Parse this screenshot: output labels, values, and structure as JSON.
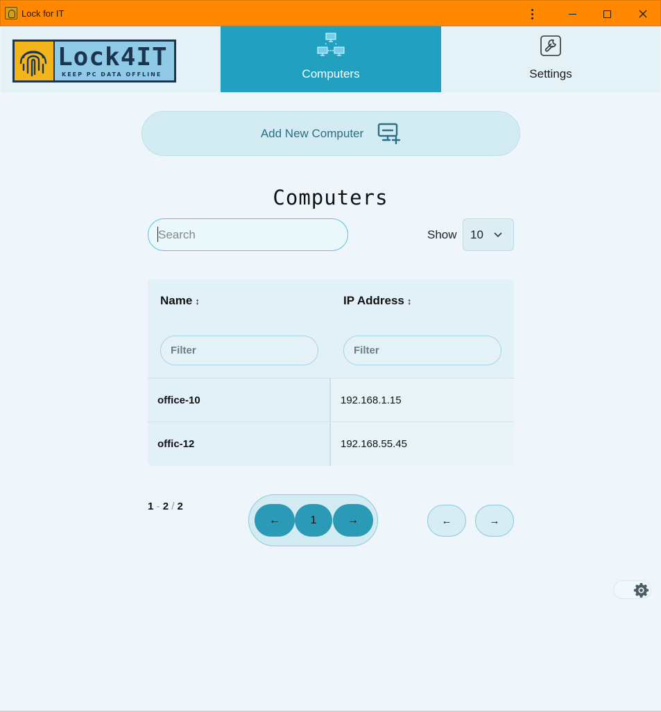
{
  "window": {
    "title": "Lock for IT",
    "controls": {
      "more": "more-options",
      "minimize": "minimize",
      "maximize": "maximize",
      "close": "close"
    }
  },
  "header": {
    "logo": {
      "main": "Lock4IT",
      "tagline": "KEEP PC DATA OFFLINE"
    },
    "tabs": [
      {
        "label": "Computers",
        "icon": "network-icon",
        "active": true
      },
      {
        "label": "Settings",
        "icon": "wrench-icon",
        "active": false
      }
    ]
  },
  "actions": {
    "add_computer_label": "Add New Computer",
    "add_computer_icon": "monitor-add-icon"
  },
  "page": {
    "title": "Computers"
  },
  "search": {
    "placeholder": "Search",
    "value": ""
  },
  "show": {
    "label": "Show",
    "selected": "10"
  },
  "table": {
    "columns": [
      {
        "label": "Name",
        "sort_icon": "↕",
        "filter_placeholder": "Filter"
      },
      {
        "label": "IP Address",
        "sort_icon": "↕",
        "filter_placeholder": "Filter"
      }
    ],
    "rows": [
      {
        "name": "office-10",
        "ip": "192.168.1.15"
      },
      {
        "name": "offic-12",
        "ip": "192.168.55.45"
      }
    ]
  },
  "pagination": {
    "range_start": "1",
    "range_end": "2",
    "total": "2",
    "current_page": "1",
    "prev_icon": "←",
    "next_icon": "→"
  },
  "colors": {
    "titlebar": "#ff8800",
    "accent": "#22a0c0",
    "background": "#eef6fb"
  }
}
